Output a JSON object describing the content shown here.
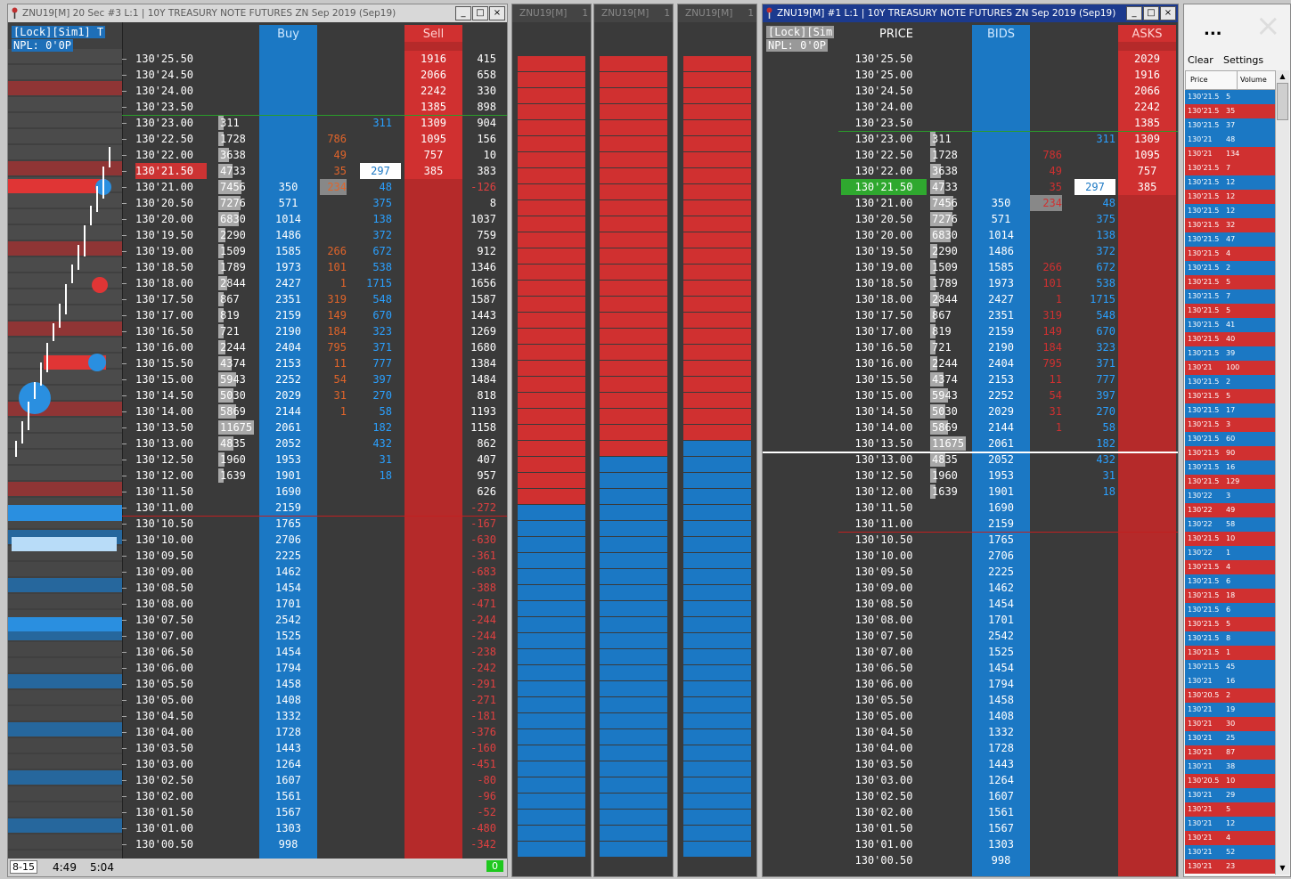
{
  "win1": {
    "title": "ZNU19[M]  20 Sec  #3  L:1 |  10Y TREASURY NOTE FUTURES ZN Sep 2019 (Sep19)",
    "lock": "[Lock][Sim1]  T",
    "npl": "NPL: 0'0P",
    "buy_header": "Buy",
    "sell_header": "Sell",
    "footer_range": "8-15",
    "footer_t1": "4:49",
    "footer_t2": "5:04",
    "footer_badge": "0"
  },
  "mini1": {
    "title": "ZNU19[M]",
    "num": "1"
  },
  "mini2": {
    "title": "ZNU19[M]",
    "num": "1"
  },
  "mini3": {
    "title": "ZNU19[M]",
    "num": "1"
  },
  "win2": {
    "title": "ZNU19[M]  #1  L:1 |  10Y TREASURY NOTE FUTURES ZN Sep 2019 (Sep19)",
    "lock": "[Lock][Sim",
    "npl": "NPL: 0'0P",
    "price_header": "PRICE",
    "bids_header": "BIDS",
    "asks_header": "ASKS"
  },
  "ts": {
    "menu_icon": "...",
    "close_icon": "×",
    "clear": "Clear",
    "settings": "Settings",
    "col_price": "Price",
    "col_volume": "Volume"
  },
  "colors": {
    "bid": "#1b78c4",
    "ask": "#d03030",
    "bg": "#3a3a3a"
  }
}
